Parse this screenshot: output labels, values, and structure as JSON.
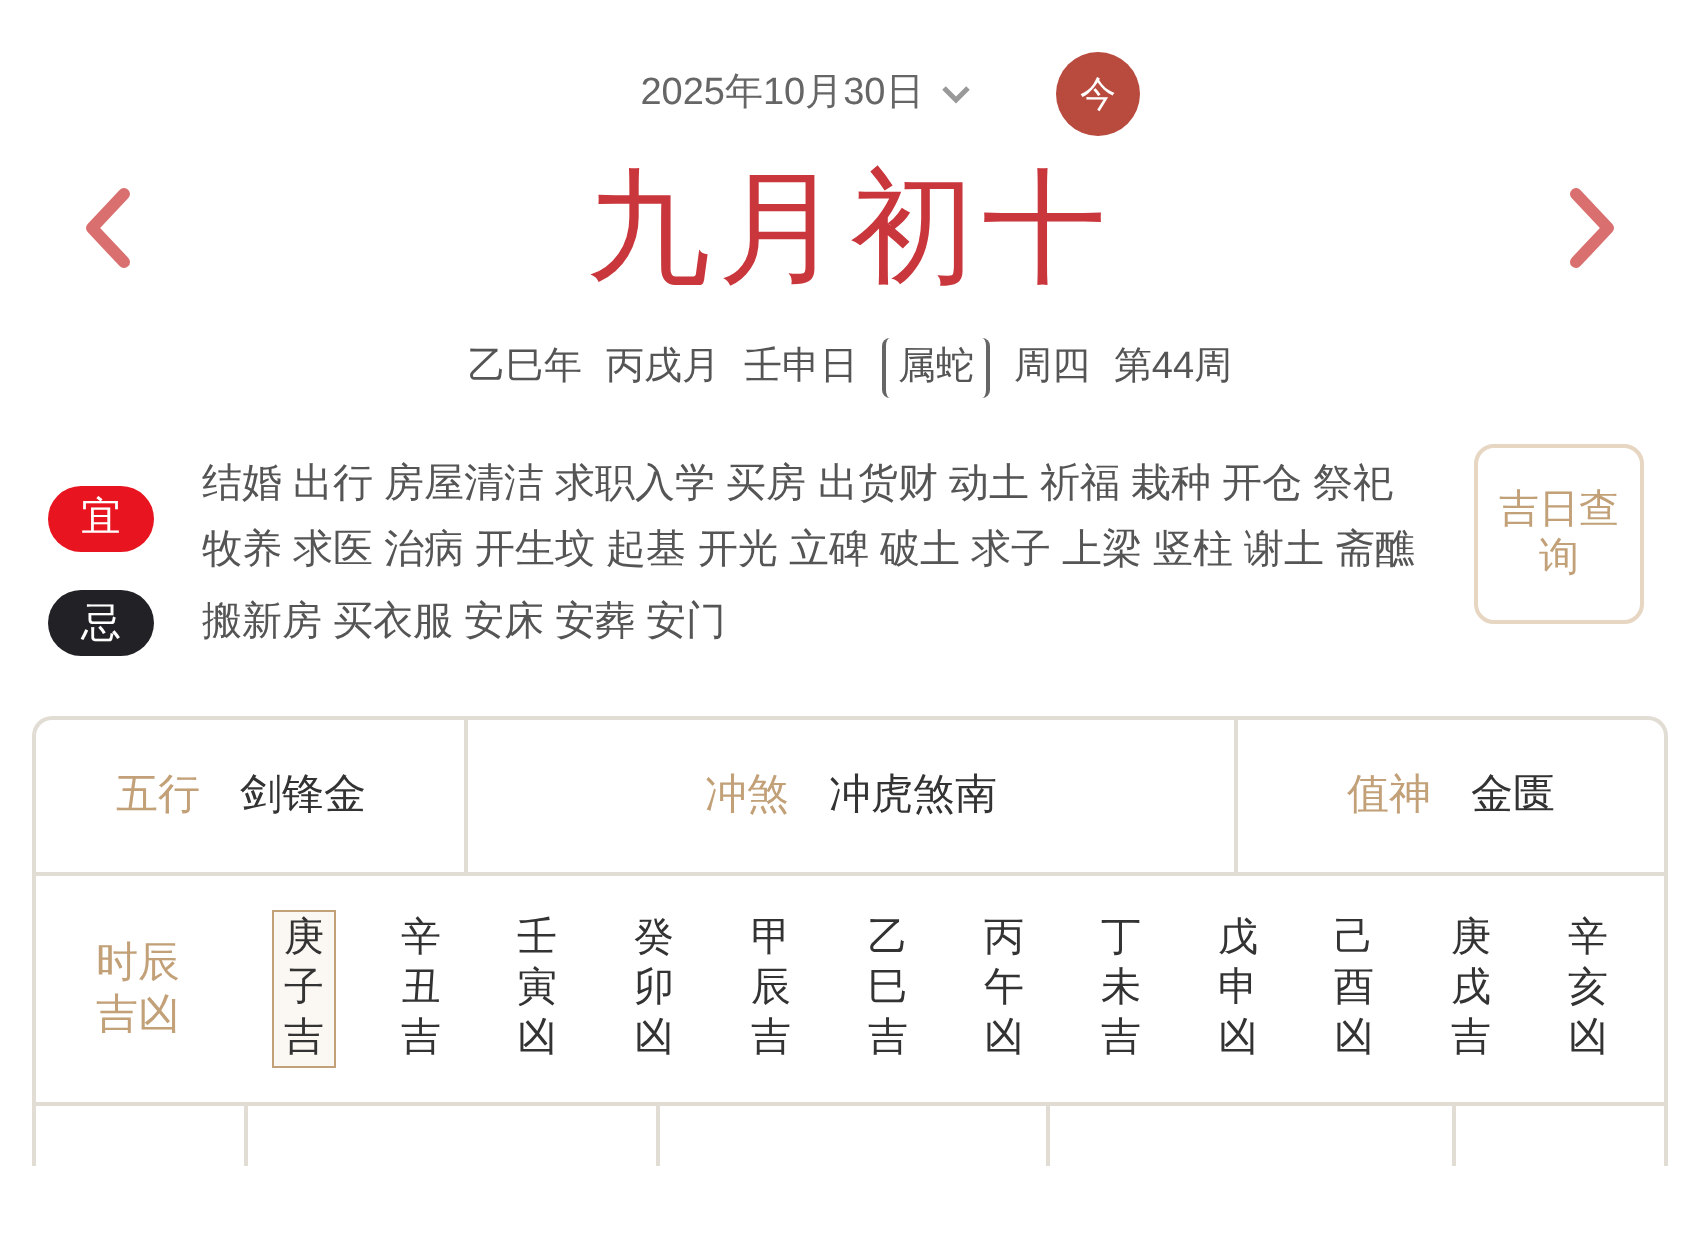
{
  "date_picker": {
    "value": "2025年10月30日"
  },
  "today_button": "今",
  "lunar_date": "九月初十",
  "ganzhi": [
    {
      "text": "乙巳年",
      "kind": "plain"
    },
    {
      "text": "丙戌月",
      "kind": "plain"
    },
    {
      "text": "壬申日",
      "kind": "plain"
    },
    {
      "text": "属蛇",
      "kind": "bracket"
    },
    {
      "text": "周四",
      "kind": "plain"
    },
    {
      "text": "第44周",
      "kind": "plain"
    }
  ],
  "suitable": {
    "label": "宜",
    "items": [
      "结婚",
      "出行",
      "房屋清洁",
      "求职入学",
      "买房",
      "出货财",
      "动土",
      "祈福",
      "栽种",
      "开仓",
      "祭祀",
      "牧养",
      "求医",
      "治病",
      "开生坟",
      "起基",
      "开光",
      "立碑",
      "破土",
      "求子",
      "上梁",
      "竖柱",
      "谢土",
      "斋醮"
    ]
  },
  "avoid": {
    "label": "忌",
    "items": [
      "搬新房",
      "买衣服",
      "安床",
      "安葬",
      "安门"
    ]
  },
  "lucky_day_button": "吉日查询",
  "info": [
    {
      "label": "五行",
      "value": "剑锋金"
    },
    {
      "label": "冲煞",
      "value": "冲虎煞南"
    },
    {
      "label": "值神",
      "value": "金匮"
    }
  ],
  "hours": {
    "label": "时辰吉凶",
    "items": [
      {
        "text": "庚子吉",
        "selected": true
      },
      {
        "text": "辛丑吉",
        "selected": false
      },
      {
        "text": "壬寅凶",
        "selected": false
      },
      {
        "text": "癸卯凶",
        "selected": false
      },
      {
        "text": "甲辰吉",
        "selected": false
      },
      {
        "text": "乙巳吉",
        "selected": false
      },
      {
        "text": "丙午凶",
        "selected": false
      },
      {
        "text": "丁未吉",
        "selected": false
      },
      {
        "text": "戊申凶",
        "selected": false
      },
      {
        "text": "己酉凶",
        "selected": false
      },
      {
        "text": "庚戌吉",
        "selected": false
      },
      {
        "text": "辛亥凶",
        "selected": false
      }
    ]
  }
}
